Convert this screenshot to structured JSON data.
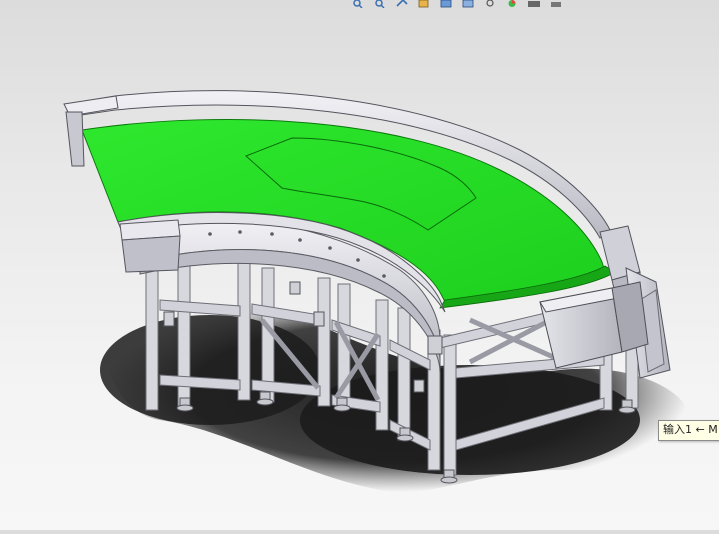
{
  "viewport": {
    "background_top": "#dcdcdc",
    "background_bottom": "#f7f7f7",
    "model_colors": {
      "belt": "#22dd22",
      "belt_dark": "#17b417",
      "frame": "#d6d6dc",
      "frame_shadow": "#a9a9b3",
      "shadow": "#1e1e1e"
    }
  },
  "hud_toolbar": {
    "buttons": [
      {
        "icon": "zoom-to-fit-icon"
      },
      {
        "icon": "zoom-to-area-icon"
      },
      {
        "icon": "previous-view-icon"
      },
      {
        "icon": "section-view-icon"
      },
      {
        "icon": "view-orientation-icon"
      },
      {
        "icon": "display-style-icon"
      },
      {
        "icon": "hide-show-items-icon"
      },
      {
        "icon": "edit-appearance-icon"
      },
      {
        "icon": "apply-scene-icon"
      },
      {
        "icon": "view-settings-icon"
      }
    ]
  },
  "tooltip": {
    "text": "输入1 ← M"
  }
}
